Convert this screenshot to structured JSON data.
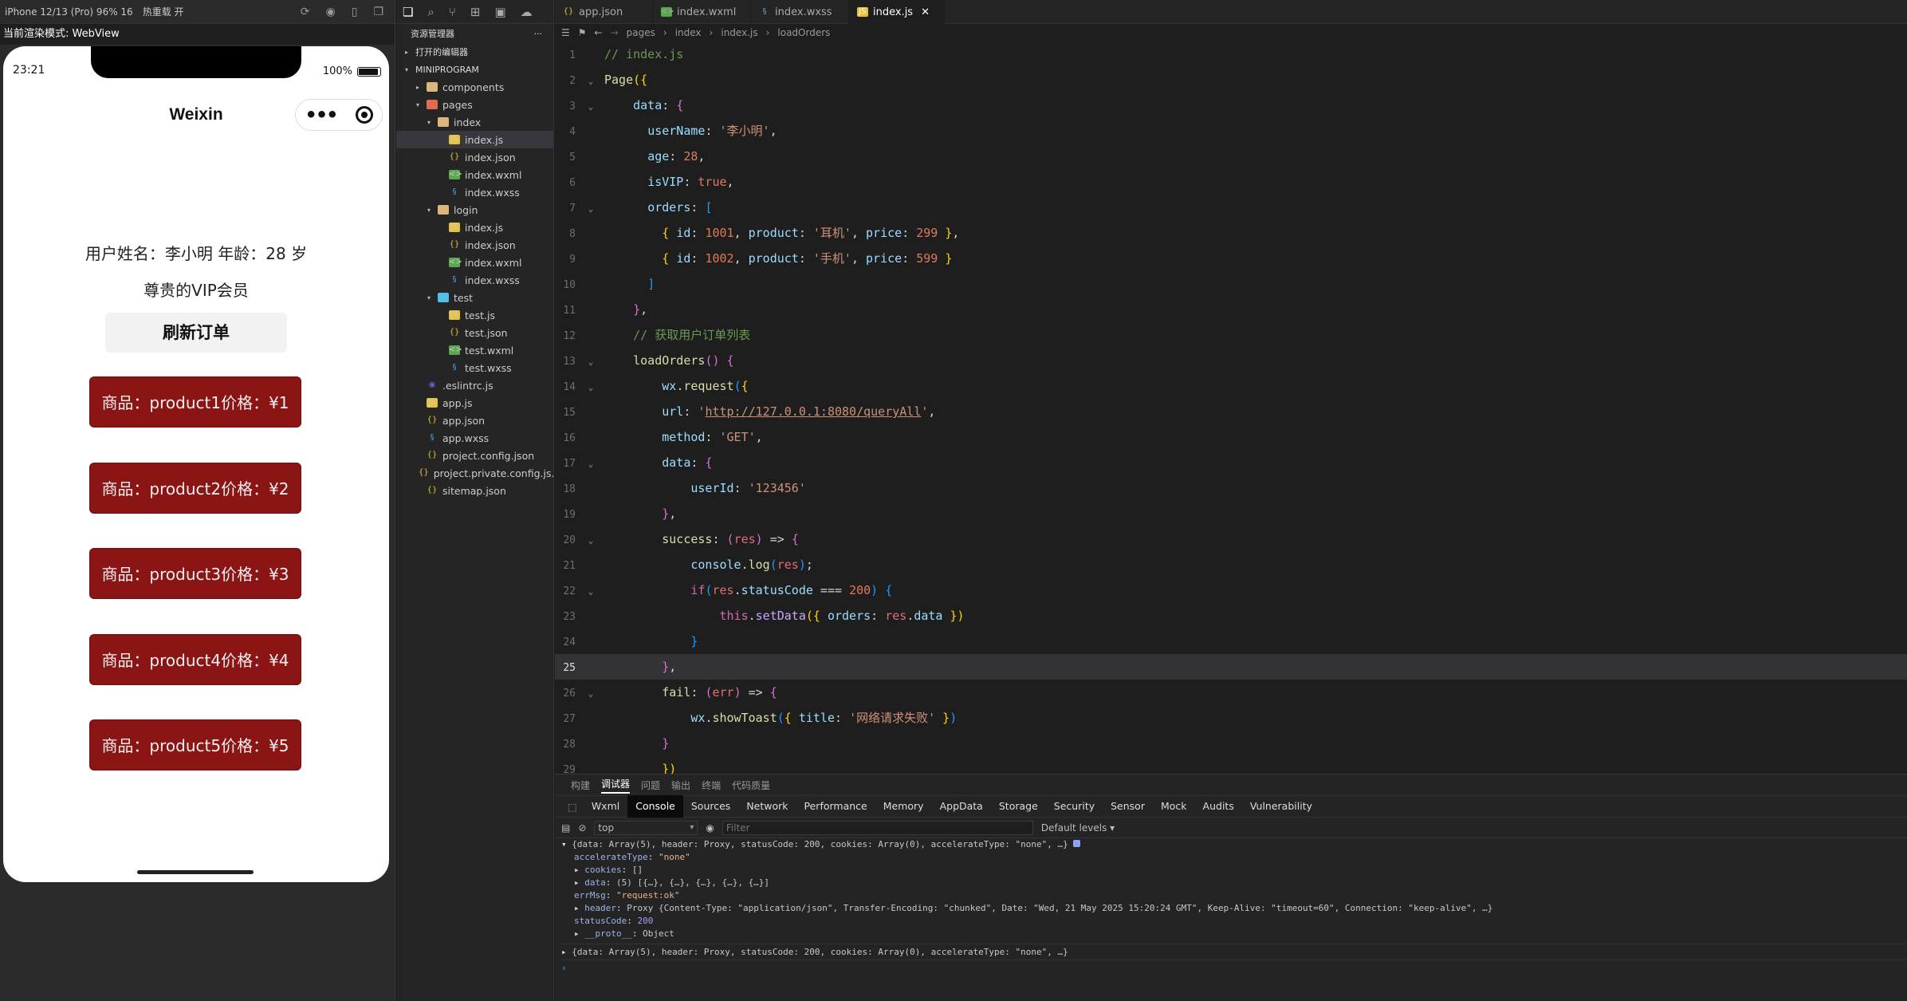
{
  "simulator": {
    "device": "iPhone 12/13 (Pro) 96% 16",
    "hot_reload": "热重载 开",
    "render_mode": "当前渲染模式: WebView",
    "status_time": "23:21",
    "battery": "100%",
    "nav_title": "Weixin",
    "info_line": "用户姓名：李小明 年龄：28 岁",
    "vip_line": "尊贵的VIP会员",
    "refresh_label": "刷新订单",
    "orders": [
      "商品：product1价格：¥1",
      "商品：product2价格：¥2",
      "商品：product3价格：¥3",
      "商品：product4价格：¥4",
      "商品：product5价格：¥5"
    ]
  },
  "explorer": {
    "title": "资源管理器",
    "more": "···",
    "open_editors": "打开的编辑器",
    "root": "MINIPROGRAM",
    "tree": [
      {
        "label": "components",
        "depth": 1,
        "type": "folder",
        "twisty": "▸"
      },
      {
        "label": "pages",
        "depth": 1,
        "type": "pages",
        "twisty": "▾"
      },
      {
        "label": "index",
        "depth": 2,
        "type": "folder",
        "twisty": "▾"
      },
      {
        "label": "index.js",
        "depth": 3,
        "type": "js",
        "selected": true
      },
      {
        "label": "index.json",
        "depth": 3,
        "type": "json"
      },
      {
        "label": "index.wxml",
        "depth": 3,
        "type": "wxml"
      },
      {
        "label": "index.wxss",
        "depth": 3,
        "type": "wxss"
      },
      {
        "label": "login",
        "depth": 2,
        "type": "folder",
        "twisty": "▾"
      },
      {
        "label": "index.js",
        "depth": 3,
        "type": "js"
      },
      {
        "label": "index.json",
        "depth": 3,
        "type": "json"
      },
      {
        "label": "index.wxml",
        "depth": 3,
        "type": "wxml"
      },
      {
        "label": "index.wxss",
        "depth": 3,
        "type": "wxss"
      },
      {
        "label": "test",
        "depth": 2,
        "type": "test",
        "twisty": "▾"
      },
      {
        "label": "test.js",
        "depth": 3,
        "type": "js"
      },
      {
        "label": "test.json",
        "depth": 3,
        "type": "json"
      },
      {
        "label": "test.wxml",
        "depth": 3,
        "type": "wxml"
      },
      {
        "label": "test.wxss",
        "depth": 3,
        "type": "wxss"
      },
      {
        "label": ".eslintrc.js",
        "depth": 1,
        "type": "eslint"
      },
      {
        "label": "app.js",
        "depth": 1,
        "type": "js"
      },
      {
        "label": "app.json",
        "depth": 1,
        "type": "json"
      },
      {
        "label": "app.wxss",
        "depth": 1,
        "type": "wxss"
      },
      {
        "label": "project.config.json",
        "depth": 1,
        "type": "json"
      },
      {
        "label": "project.private.config.js...",
        "depth": 1,
        "type": "json"
      },
      {
        "label": "sitemap.json",
        "depth": 1,
        "type": "json"
      }
    ]
  },
  "editor": {
    "tabs": [
      {
        "label": "app.json",
        "type": "json"
      },
      {
        "label": "index.wxml",
        "type": "wxml"
      },
      {
        "label": "index.wxss",
        "type": "wxss"
      },
      {
        "label": "index.js",
        "type": "js",
        "active": true
      }
    ],
    "breadcrumb": [
      "pages",
      "index",
      "index.js",
      "loadOrders"
    ],
    "current_line": 25,
    "lines": [
      {
        "n": 1,
        "t": [
          [
            "cm",
            "// index.js"
          ]
        ]
      },
      {
        "n": 2,
        "fold": true,
        "t": [
          [
            "fn",
            "Page"
          ],
          [
            "br",
            "({"
          ]
        ]
      },
      {
        "n": 3,
        "fold": true,
        "t": [
          [
            "pn",
            "    "
          ],
          [
            "prop",
            "data"
          ],
          [
            "pn",
            ": "
          ],
          [
            "br2",
            "{"
          ]
        ]
      },
      {
        "n": 4,
        "t": [
          [
            "pn",
            "      "
          ],
          [
            "prop",
            "userName"
          ],
          [
            "pn",
            ": "
          ],
          [
            "str",
            "'李小明'"
          ],
          [
            "pn",
            ","
          ]
        ]
      },
      {
        "n": 5,
        "t": [
          [
            "pn",
            "      "
          ],
          [
            "prop",
            "age"
          ],
          [
            "pn",
            ": "
          ],
          [
            "num",
            "28"
          ],
          [
            "pn",
            ","
          ]
        ]
      },
      {
        "n": 6,
        "t": [
          [
            "pn",
            "      "
          ],
          [
            "prop",
            "isVIP"
          ],
          [
            "pn",
            ": "
          ],
          [
            "bool",
            "true"
          ],
          [
            "pn",
            ","
          ]
        ]
      },
      {
        "n": 7,
        "fold": true,
        "t": [
          [
            "pn",
            "      "
          ],
          [
            "prop",
            "orders"
          ],
          [
            "pn",
            ": "
          ],
          [
            "br3",
            "["
          ]
        ]
      },
      {
        "n": 8,
        "t": [
          [
            "pn",
            "        "
          ],
          [
            "br",
            "{ "
          ],
          [
            "prop",
            "id"
          ],
          [
            "pn",
            ": "
          ],
          [
            "num",
            "1001"
          ],
          [
            "pn",
            ", "
          ],
          [
            "prop",
            "product"
          ],
          [
            "pn",
            ": "
          ],
          [
            "str",
            "'耳机'"
          ],
          [
            "pn",
            ", "
          ],
          [
            "prop",
            "price"
          ],
          [
            "pn",
            ": "
          ],
          [
            "num",
            "299"
          ],
          [
            "br",
            " }"
          ],
          [
            "pn",
            ","
          ]
        ]
      },
      {
        "n": 9,
        "t": [
          [
            "pn",
            "        "
          ],
          [
            "br",
            "{ "
          ],
          [
            "prop",
            "id"
          ],
          [
            "pn",
            ": "
          ],
          [
            "num",
            "1002"
          ],
          [
            "pn",
            ", "
          ],
          [
            "prop",
            "product"
          ],
          [
            "pn",
            ": "
          ],
          [
            "str",
            "'手机'"
          ],
          [
            "pn",
            ", "
          ],
          [
            "prop",
            "price"
          ],
          [
            "pn",
            ": "
          ],
          [
            "num",
            "599"
          ],
          [
            "br",
            " }"
          ]
        ]
      },
      {
        "n": 10,
        "t": [
          [
            "pn",
            "      "
          ],
          [
            "br3",
            "]"
          ]
        ]
      },
      {
        "n": 11,
        "t": [
          [
            "pn",
            "    "
          ],
          [
            "br2",
            "}"
          ],
          [
            "pn",
            ","
          ]
        ]
      },
      {
        "n": 12,
        "t": [
          [
            "pn",
            "    "
          ],
          [
            "cm",
            "// 获取用户订单列表"
          ]
        ]
      },
      {
        "n": 13,
        "fold": true,
        "t": [
          [
            "pn",
            "    "
          ],
          [
            "fn",
            "loadOrders"
          ],
          [
            "br2",
            "()"
          ],
          [
            "pn",
            " "
          ],
          [
            "br2",
            "{"
          ]
        ]
      },
      {
        "n": 14,
        "fold": true,
        "t": [
          [
            "pn",
            "        "
          ],
          [
            "prop",
            "wx"
          ],
          [
            "pn",
            "."
          ],
          [
            "fn",
            "request"
          ],
          [
            "br3",
            "("
          ],
          [
            "br",
            "{"
          ]
        ]
      },
      {
        "n": 15,
        "t": [
          [
            "pn",
            "        "
          ],
          [
            "prop",
            "url"
          ],
          [
            "pn",
            ": "
          ],
          [
            "str",
            "'"
          ],
          [
            "url",
            "http://127.0.0.1:8080/queryAll"
          ],
          [
            "str",
            "'"
          ],
          [
            "pn",
            ","
          ]
        ]
      },
      {
        "n": 16,
        "t": [
          [
            "pn",
            "        "
          ],
          [
            "prop",
            "method"
          ],
          [
            "pn",
            ": "
          ],
          [
            "str",
            "'GET'"
          ],
          [
            "pn",
            ","
          ]
        ]
      },
      {
        "n": 17,
        "fold": true,
        "t": [
          [
            "pn",
            "        "
          ],
          [
            "prop",
            "data"
          ],
          [
            "pn",
            ": "
          ],
          [
            "br2",
            "{"
          ]
        ]
      },
      {
        "n": 18,
        "t": [
          [
            "pn",
            "            "
          ],
          [
            "prop",
            "userId"
          ],
          [
            "pn",
            ": "
          ],
          [
            "str",
            "'123456'"
          ]
        ]
      },
      {
        "n": 19,
        "t": [
          [
            "pn",
            "        "
          ],
          [
            "br2",
            "}"
          ],
          [
            "pn",
            ","
          ]
        ]
      },
      {
        "n": 20,
        "fold": true,
        "t": [
          [
            "pn",
            "        "
          ],
          [
            "fn",
            "success"
          ],
          [
            "pn",
            ": "
          ],
          [
            "br2",
            "("
          ],
          [
            "prm",
            "res"
          ],
          [
            "br2",
            ")"
          ],
          [
            "pn",
            " => "
          ],
          [
            "br2",
            "{"
          ]
        ]
      },
      {
        "n": 21,
        "t": [
          [
            "pn",
            "            "
          ],
          [
            "prop",
            "console"
          ],
          [
            "pn",
            "."
          ],
          [
            "fn",
            "log"
          ],
          [
            "br3",
            "("
          ],
          [
            "prm",
            "res"
          ],
          [
            "br3",
            ")"
          ],
          [
            "pn",
            ";"
          ]
        ]
      },
      {
        "n": 22,
        "fold": true,
        "t": [
          [
            "pn",
            "            "
          ],
          [
            "kw",
            "if"
          ],
          [
            "br3",
            "("
          ],
          [
            "prm",
            "res"
          ],
          [
            "pn",
            "."
          ],
          [
            "prop",
            "statusCode"
          ],
          [
            "pn",
            " === "
          ],
          [
            "num",
            "200"
          ],
          [
            "br3",
            ")"
          ],
          [
            "pn",
            " "
          ],
          [
            "br3",
            "{"
          ]
        ]
      },
      {
        "n": 23,
        "t": [
          [
            "pn",
            "                "
          ],
          [
            "kw",
            "this"
          ],
          [
            "pn",
            "."
          ],
          [
            "fnp",
            "setData"
          ],
          [
            "br",
            "({ "
          ],
          [
            "prop",
            "orders"
          ],
          [
            "pn",
            ": "
          ],
          [
            "prm",
            "res"
          ],
          [
            "pn",
            "."
          ],
          [
            "prop",
            "data"
          ],
          [
            "br",
            " })"
          ]
        ]
      },
      {
        "n": 24,
        "t": [
          [
            "pn",
            "            "
          ],
          [
            "br3",
            "}"
          ]
        ]
      },
      {
        "n": 25,
        "t": [
          [
            "pn",
            "        "
          ],
          [
            "br2",
            "}"
          ],
          [
            "pn",
            ","
          ]
        ]
      },
      {
        "n": 26,
        "fold": true,
        "t": [
          [
            "pn",
            "        "
          ],
          [
            "fn",
            "fail"
          ],
          [
            "pn",
            ": "
          ],
          [
            "br2",
            "("
          ],
          [
            "prm",
            "err"
          ],
          [
            "br2",
            ")"
          ],
          [
            "pn",
            " => "
          ],
          [
            "br2",
            "{"
          ]
        ]
      },
      {
        "n": 27,
        "t": [
          [
            "pn",
            "            "
          ],
          [
            "prop",
            "wx"
          ],
          [
            "pn",
            "."
          ],
          [
            "fn",
            "showToast"
          ],
          [
            "br3",
            "("
          ],
          [
            "br",
            "{ "
          ],
          [
            "prop",
            "title"
          ],
          [
            "pn",
            ": "
          ],
          [
            "str",
            "'网络请求失败'"
          ],
          [
            "br",
            " }"
          ],
          [
            "br3",
            ")"
          ]
        ]
      },
      {
        "n": 28,
        "t": [
          [
            "pn",
            "        "
          ],
          [
            "br2",
            "}"
          ]
        ]
      },
      {
        "n": 29,
        "t": [
          [
            "pn",
            "        "
          ],
          [
            "br",
            "})"
          ]
        ]
      }
    ]
  },
  "panel": {
    "tabs": [
      "构建",
      "调试器",
      "问题",
      "输出",
      "终端",
      "代码质量"
    ],
    "active_tab": "调试器",
    "devtools_tabs": [
      "Wxml",
      "Console",
      "Sources",
      "Network",
      "Performance",
      "Memory",
      "AppData",
      "Storage",
      "Security",
      "Sensor",
      "Mock",
      "Audits",
      "Vulnerability"
    ],
    "active_devtool": "Console",
    "context": "top",
    "filter_placeholder": "Filter",
    "levels": "Default levels ▾",
    "log_summary": "{data: Array(5), header: Proxy, statusCode: 200, cookies: Array(0), accelerateType: \"none\", …}",
    "log_rows": [
      {
        "k": "accelerateType",
        "v": "\"none\"",
        "vt": "str"
      },
      {
        "k": "cookies",
        "v": "[]",
        "vt": "plain",
        "exp": true
      },
      {
        "k": "data",
        "v": "(5) [{…}, {…}, {…}, {…}, {…}]",
        "vt": "plain",
        "exp": true
      },
      {
        "k": "errMsg",
        "v": "\"request:ok\"",
        "vt": "str"
      },
      {
        "k": "header",
        "v": "Proxy {Content-Type: \"application/json\", Transfer-Encoding: \"chunked\", Date: \"Wed, 21 May 2025 15:20:24 GMT\", Keep-Alive: \"timeout=60\", Connection: \"keep-alive\", …}",
        "vt": "plain",
        "exp": true
      },
      {
        "k": "statusCode",
        "v": "200",
        "vt": "num"
      },
      {
        "k": "__proto__",
        "v": "Object",
        "vt": "plain",
        "exp": true
      }
    ],
    "log_summary2": "{data: Array(5), header: Proxy, statusCode: 200, cookies: Array(0), accelerateType: \"none\", …}",
    "prompt": "›"
  },
  "colors": {
    "accent": "#8b1414",
    "editor_bg": "#1e1e1e"
  }
}
